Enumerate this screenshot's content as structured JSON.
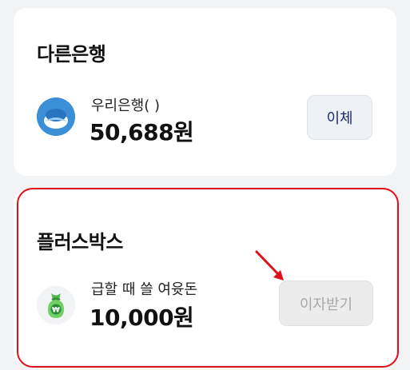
{
  "other_bank": {
    "title": "다른은행",
    "account_name": "우리은행(          )",
    "balance": "50,688원",
    "transfer_label": "이체",
    "icon": "woori-bank-logo"
  },
  "plus_box": {
    "title": "플러스박스",
    "account_name": "급할 때 쓸 여윳돈",
    "balance": "10,000원",
    "interest_label": "이자받기",
    "icon": "money-bag-won"
  },
  "colors": {
    "highlight": "#e0101a",
    "woori_blue": "#3a8fd6",
    "transfer_text": "#1b2a6b",
    "disabled_text": "#a9a9a9"
  }
}
